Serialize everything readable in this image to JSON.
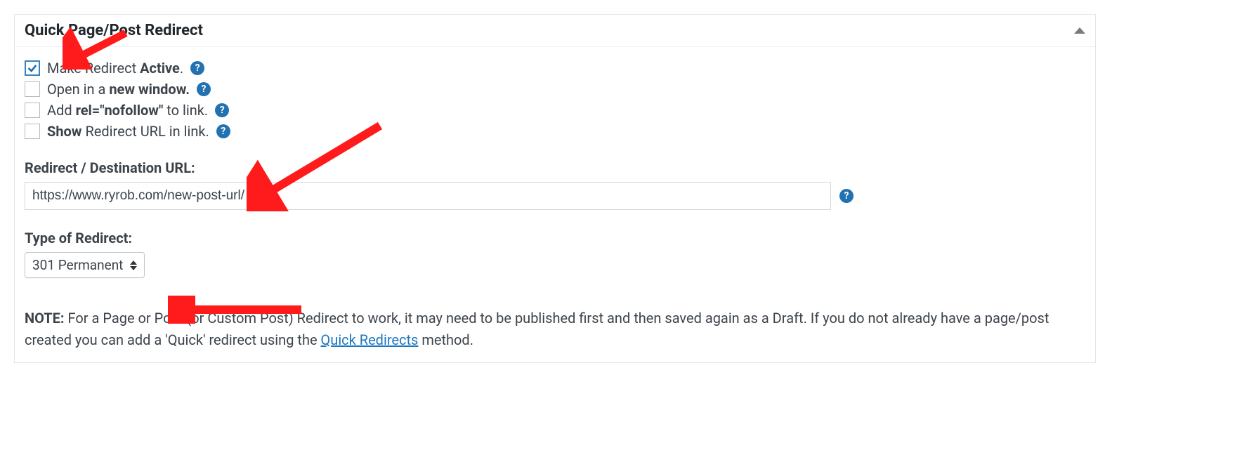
{
  "panel": {
    "title": "Quick Page/Post Redirect"
  },
  "options": {
    "active": {
      "pre": "Make Redirect ",
      "strong": "Active",
      "post": ".",
      "checked": true
    },
    "newwindow": {
      "pre": "Open in a ",
      "strong": "new window.",
      "post": "",
      "checked": false
    },
    "nofollow": {
      "pre": "Add ",
      "strong": "rel=\"nofollow\"",
      "post": " to link.",
      "checked": false
    },
    "showurl": {
      "prestrong": "Show",
      "post": " Redirect URL in link.",
      "checked": false
    }
  },
  "url": {
    "label": "Redirect / Destination URL:",
    "value": "https://www.ryrob.com/new-post-url/"
  },
  "redirect_type": {
    "label": "Type of Redirect:",
    "selected": "301 Permanent"
  },
  "note": {
    "strong": "NOTE:",
    "text1": " For a Page or Post (or Custom Post) Redirect to work, it may need to be published first and then saved again as a Draft. If you do not already have a page/post created you can add a 'Quick' redirect using the ",
    "link": "Quick Redirects",
    "text2": " method."
  },
  "help_glyph": "?"
}
